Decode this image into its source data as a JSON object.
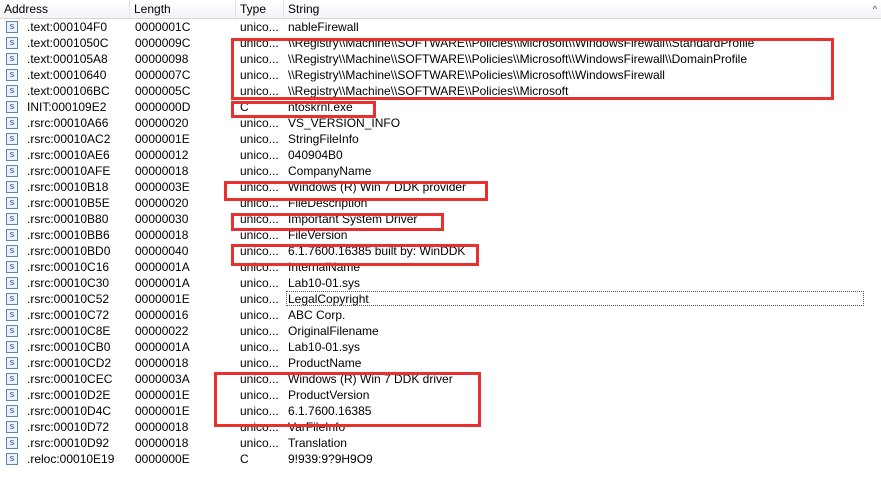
{
  "columns": {
    "address": "Address",
    "length": "Length",
    "type": "Type",
    "string": "String",
    "sort_indicator": "^"
  },
  "row_icon": "s",
  "accent": {
    "highlight_red": "#e8302e"
  },
  "rows": [
    {
      "address": ".text:000104F0",
      "length": "0000001C",
      "type": "unico...",
      "string": "nableFirewall"
    },
    {
      "address": ".text:0001050C",
      "length": "0000009C",
      "type": "unico...",
      "string": "\\\\Registry\\\\Machine\\\\SOFTWARE\\\\Policies\\\\Microsoft\\\\WindowsFirewall\\\\StandardProfile"
    },
    {
      "address": ".text:000105A8",
      "length": "00000098",
      "type": "unico...",
      "string": "\\\\Registry\\\\Machine\\\\SOFTWARE\\\\Policies\\\\Microsoft\\\\WindowsFirewall\\\\DomainProfile"
    },
    {
      "address": ".text:00010640",
      "length": "0000007C",
      "type": "unico...",
      "string": "\\\\Registry\\\\Machine\\\\SOFTWARE\\\\Policies\\\\Microsoft\\\\WindowsFirewall"
    },
    {
      "address": ".text:000106BC",
      "length": "0000005C",
      "type": "unico...",
      "string": "\\\\Registry\\\\Machine\\\\SOFTWARE\\\\Policies\\\\Microsoft"
    },
    {
      "address": "INIT:000109E2",
      "length": "0000000D",
      "type": "C",
      "string": "ntoskrnl.exe"
    },
    {
      "address": ".rsrc:00010A66",
      "length": "00000020",
      "type": "unico...",
      "string": "VS_VERSION_INFO"
    },
    {
      "address": ".rsrc:00010AC2",
      "length": "0000001E",
      "type": "unico...",
      "string": "StringFileInfo"
    },
    {
      "address": ".rsrc:00010AE6",
      "length": "00000012",
      "type": "unico...",
      "string": "040904B0"
    },
    {
      "address": ".rsrc:00010AFE",
      "length": "00000018",
      "type": "unico...",
      "string": "CompanyName"
    },
    {
      "address": ".rsrc:00010B18",
      "length": "0000003E",
      "type": "unico...",
      "string": "Windows (R) Win 7 DDK provider"
    },
    {
      "address": ".rsrc:00010B5E",
      "length": "00000020",
      "type": "unico...",
      "string": "FileDescription"
    },
    {
      "address": ".rsrc:00010B80",
      "length": "00000030",
      "type": "unico...",
      "string": "Important System Driver"
    },
    {
      "address": ".rsrc:00010BB6",
      "length": "00000018",
      "type": "unico...",
      "string": "FileVersion"
    },
    {
      "address": ".rsrc:00010BD0",
      "length": "00000040",
      "type": "unico...",
      "string": "6.1.7600.16385 built by: WinDDK"
    },
    {
      "address": ".rsrc:00010C16",
      "length": "0000001A",
      "type": "unico...",
      "string": "InternalName"
    },
    {
      "address": ".rsrc:00010C30",
      "length": "0000001A",
      "type": "unico...",
      "string": "Lab10-01.sys"
    },
    {
      "address": ".rsrc:00010C52",
      "length": "0000001E",
      "type": "unico...",
      "string": "LegalCopyright"
    },
    {
      "address": ".rsrc:00010C72",
      "length": "00000016",
      "type": "unico...",
      "string": " ABC Corp."
    },
    {
      "address": ".rsrc:00010C8E",
      "length": "00000022",
      "type": "unico...",
      "string": "OriginalFilename"
    },
    {
      "address": ".rsrc:00010CB0",
      "length": "0000001A",
      "type": "unico...",
      "string": "Lab10-01.sys"
    },
    {
      "address": ".rsrc:00010CD2",
      "length": "00000018",
      "type": "unico...",
      "string": "ProductName"
    },
    {
      "address": ".rsrc:00010CEC",
      "length": "0000003A",
      "type": "unico...",
      "string": "Windows (R) Win 7 DDK driver"
    },
    {
      "address": ".rsrc:00010D2E",
      "length": "0000001E",
      "type": "unico...",
      "string": "ProductVersion"
    },
    {
      "address": ".rsrc:00010D4C",
      "length": "0000001E",
      "type": "unico...",
      "string": "6.1.7600.16385"
    },
    {
      "address": ".rsrc:00010D72",
      "length": "00000018",
      "type": "unico...",
      "string": "VarFileInfo"
    },
    {
      "address": ".rsrc:00010D92",
      "length": "00000018",
      "type": "unico...",
      "string": "Translation"
    },
    {
      "address": ".reloc:00010E19",
      "length": "0000000E",
      "type": "C",
      "string": "9!939:9?9H9O9"
    }
  ]
}
